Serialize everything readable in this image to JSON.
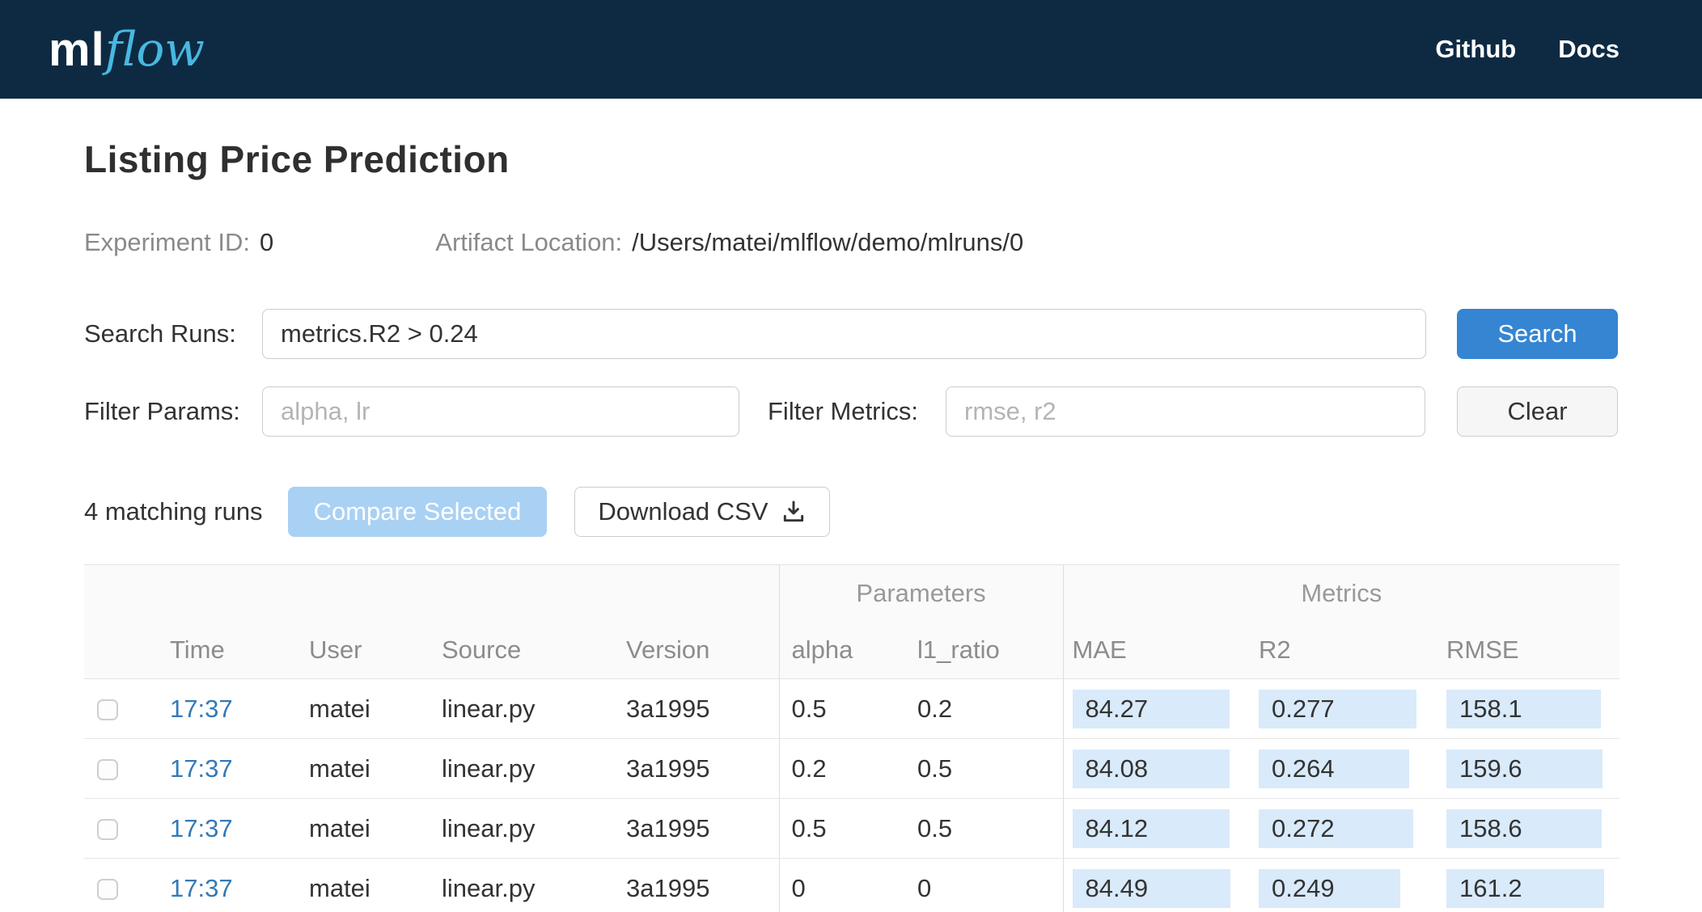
{
  "header": {
    "logo_ml": "ml",
    "logo_flow": "flow",
    "nav": [
      {
        "label": "Github"
      },
      {
        "label": "Docs"
      }
    ]
  },
  "page": {
    "title": "Listing Price Prediction",
    "experiment_id_label": "Experiment ID:",
    "experiment_id": "0",
    "artifact_location_label": "Artifact Location:",
    "artifact_location": "/Users/matei/mlflow/demo/mlruns/0"
  },
  "search": {
    "search_runs_label": "Search Runs:",
    "search_value": "metrics.R2 > 0.24",
    "search_button": "Search",
    "filter_params_label": "Filter Params:",
    "filter_params_placeholder": "alpha, lr",
    "filter_metrics_label": "Filter Metrics:",
    "filter_metrics_placeholder": "rmse, r2",
    "clear_button": "Clear"
  },
  "actions": {
    "matching_runs": "4 matching runs",
    "compare_button": "Compare Selected",
    "download_button": "Download CSV",
    "download_icon": "download-icon"
  },
  "table": {
    "group_headers": {
      "parameters": "Parameters",
      "metrics": "Metrics"
    },
    "columns": [
      "Time",
      "User",
      "Source",
      "Version",
      "alpha",
      "l1_ratio",
      "MAE",
      "R2",
      "RMSE"
    ],
    "rows": [
      {
        "time": "17:37",
        "user": "matei",
        "source": "linear.py",
        "version": "3a1995",
        "alpha": "0.5",
        "l1_ratio": "0.2",
        "mae": "84.27",
        "r2": "0.277",
        "rmse": "158.1"
      },
      {
        "time": "17:37",
        "user": "matei",
        "source": "linear.py",
        "version": "3a1995",
        "alpha": "0.2",
        "l1_ratio": "0.5",
        "mae": "84.08",
        "r2": "0.264",
        "rmse": "159.6"
      },
      {
        "time": "17:37",
        "user": "matei",
        "source": "linear.py",
        "version": "3a1995",
        "alpha": "0.5",
        "l1_ratio": "0.5",
        "mae": "84.12",
        "r2": "0.272",
        "rmse": "158.6"
      },
      {
        "time": "17:37",
        "user": "matei",
        "source": "linear.py",
        "version": "3a1995",
        "alpha": "0",
        "l1_ratio": "0",
        "mae": "84.49",
        "r2": "0.249",
        "rmse": "161.2"
      }
    ]
  },
  "colors": {
    "header_bg": "#0e2a43",
    "logo_flow": "#48b8e0",
    "primary_button": "#3585d3",
    "disabled_primary_button": "#a9d1f4",
    "link": "#337ab7",
    "metric_highlight": "#d9eafa"
  }
}
